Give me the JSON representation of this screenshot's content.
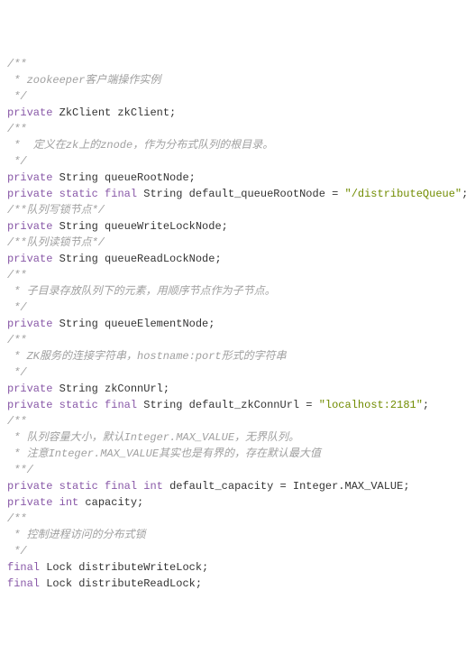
{
  "lines": [
    {
      "type": "comment",
      "text": "/**"
    },
    {
      "type": "comment",
      "text": " * zookeeper客户端操作实例"
    },
    {
      "type": "comment",
      "text": " */"
    },
    {
      "segments": [
        {
          "cls": "keyword",
          "text": "private"
        },
        {
          "cls": "plain",
          "text": " ZkClient zkClient;"
        }
      ]
    },
    {
      "type": "blank",
      "text": ""
    },
    {
      "type": "comment",
      "text": "/**"
    },
    {
      "type": "comment",
      "text": " *  定义在zk上的znode，作为分布式队列的根目录。"
    },
    {
      "type": "comment",
      "text": " */"
    },
    {
      "segments": [
        {
          "cls": "keyword",
          "text": "private"
        },
        {
          "cls": "plain",
          "text": " String queueRootNode;"
        }
      ]
    },
    {
      "segments": [
        {
          "cls": "keyword",
          "text": "private"
        },
        {
          "cls": "plain",
          "text": " "
        },
        {
          "cls": "keyword",
          "text": "static"
        },
        {
          "cls": "plain",
          "text": " "
        },
        {
          "cls": "keyword",
          "text": "final"
        },
        {
          "cls": "plain",
          "text": " String default_queueRootNode = "
        },
        {
          "cls": "string",
          "text": "\"/distributeQueue\""
        },
        {
          "cls": "plain",
          "text": ";"
        }
      ]
    },
    {
      "type": "blank",
      "text": ""
    },
    {
      "type": "comment",
      "text": "/**队列写锁节点*/"
    },
    {
      "segments": [
        {
          "cls": "keyword",
          "text": "private"
        },
        {
          "cls": "plain",
          "text": " String queueWriteLockNode;"
        }
      ]
    },
    {
      "type": "comment",
      "text": "/**队列读锁节点*/"
    },
    {
      "segments": [
        {
          "cls": "keyword",
          "text": "private"
        },
        {
          "cls": "plain",
          "text": " String queueReadLockNode;"
        }
      ]
    },
    {
      "type": "comment",
      "text": "/**"
    },
    {
      "type": "comment",
      "text": " * 子目录存放队列下的元素，用顺序节点作为子节点。"
    },
    {
      "type": "comment",
      "text": " */"
    },
    {
      "segments": [
        {
          "cls": "keyword",
          "text": "private"
        },
        {
          "cls": "plain",
          "text": " String queueElementNode;"
        }
      ]
    },
    {
      "type": "blank",
      "text": ""
    },
    {
      "type": "comment",
      "text": "/**"
    },
    {
      "type": "comment",
      "text": " * ZK服务的连接字符串，hostname:port形式的字符串"
    },
    {
      "type": "comment",
      "text": " */"
    },
    {
      "segments": [
        {
          "cls": "keyword",
          "text": "private"
        },
        {
          "cls": "plain",
          "text": " String zkConnUrl;"
        }
      ]
    },
    {
      "type": "blank",
      "text": ""
    },
    {
      "segments": [
        {
          "cls": "keyword",
          "text": "private"
        },
        {
          "cls": "plain",
          "text": " "
        },
        {
          "cls": "keyword",
          "text": "static"
        },
        {
          "cls": "plain",
          "text": " "
        },
        {
          "cls": "keyword",
          "text": "final"
        },
        {
          "cls": "plain",
          "text": " String default_zkConnUrl = "
        },
        {
          "cls": "string",
          "text": "\"localhost:2181\""
        },
        {
          "cls": "plain",
          "text": ";"
        }
      ]
    },
    {
      "type": "blank",
      "text": ""
    },
    {
      "type": "comment",
      "text": "/**"
    },
    {
      "type": "comment",
      "text": " * 队列容量大小，默认Integer.MAX_VALUE，无界队列。"
    },
    {
      "type": "comment",
      "text": " * 注意Integer.MAX_VALUE其实也是有界的，存在默认最大值"
    },
    {
      "type": "comment",
      "text": " **/"
    },
    {
      "segments": [
        {
          "cls": "keyword",
          "text": "private"
        },
        {
          "cls": "plain",
          "text": " "
        },
        {
          "cls": "keyword",
          "text": "static"
        },
        {
          "cls": "plain",
          "text": " "
        },
        {
          "cls": "keyword",
          "text": "final"
        },
        {
          "cls": "plain",
          "text": " "
        },
        {
          "cls": "keyword",
          "text": "int"
        },
        {
          "cls": "plain",
          "text": " default_capacity = Integer.MAX_VALUE;"
        }
      ]
    },
    {
      "segments": [
        {
          "cls": "keyword",
          "text": "private"
        },
        {
          "cls": "plain",
          "text": " "
        },
        {
          "cls": "keyword",
          "text": "int"
        },
        {
          "cls": "plain",
          "text": " capacity;"
        }
      ]
    },
    {
      "type": "blank",
      "text": ""
    },
    {
      "type": "comment",
      "text": "/**"
    },
    {
      "type": "comment",
      "text": " * 控制进程访问的分布式锁"
    },
    {
      "type": "comment",
      "text": " */"
    },
    {
      "segments": [
        {
          "cls": "keyword",
          "text": "final"
        },
        {
          "cls": "plain",
          "text": " Lock distributeWriteLock;"
        }
      ]
    },
    {
      "segments": [
        {
          "cls": "keyword",
          "text": "final"
        },
        {
          "cls": "plain",
          "text": " Lock distributeReadLock;"
        }
      ]
    }
  ]
}
